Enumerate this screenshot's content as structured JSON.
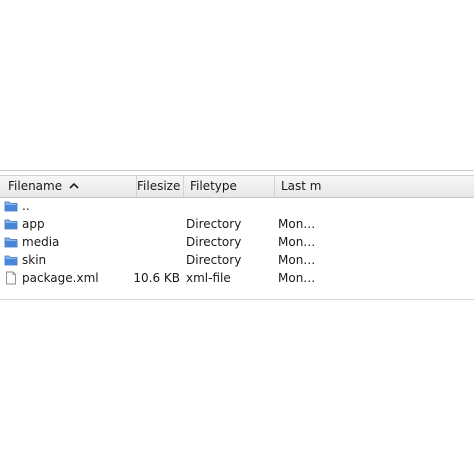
{
  "header": {
    "filename": "Filename",
    "filesize": "Filesize",
    "filetype": "Filetype",
    "last_modified": "Last m",
    "sort_icon": "chevron-up-icon"
  },
  "rows": [
    {
      "name": "..",
      "size": "",
      "type": "",
      "date": "",
      "icon": "folder-icon"
    },
    {
      "name": "app",
      "size": "",
      "type": "Directory",
      "date": "Mon…",
      "icon": "folder-icon"
    },
    {
      "name": "media",
      "size": "",
      "type": "Directory",
      "date": "Mon…",
      "icon": "folder-icon"
    },
    {
      "name": "skin",
      "size": "",
      "type": "Directory",
      "date": "Mon…",
      "icon": "folder-icon"
    },
    {
      "name": "package.xml",
      "size": "10.6 KB",
      "type": "xml-file",
      "date": "Mon…",
      "icon": "file-icon"
    }
  ],
  "colors": {
    "folder": "#4a86d8",
    "folder_light": "#8fb6ee",
    "file_border": "#8a8a8a"
  }
}
